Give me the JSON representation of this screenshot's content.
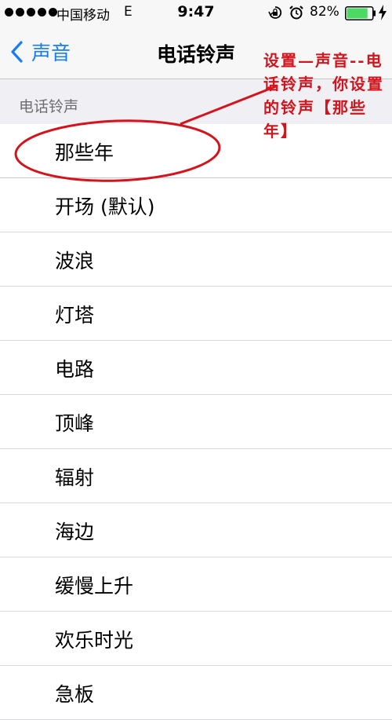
{
  "status_bar": {
    "carrier": "中国移动",
    "network": "E",
    "time": "9:47",
    "battery_percent": "82%",
    "battery_level": 0.82,
    "icons": [
      "signal-dots-icon",
      "rotation-lock-icon",
      "alarm-icon",
      "battery-icon",
      "charging-bolt-icon"
    ]
  },
  "nav": {
    "back_label": "声音",
    "title": "电话铃声"
  },
  "section": {
    "header": "电话铃声"
  },
  "ringtones": [
    "那些年",
    "开场 (默认)",
    "波浪",
    "灯塔",
    "电路",
    "顶峰",
    "辐射",
    "海边",
    "缓慢上升",
    "欢乐时光",
    "急板"
  ],
  "annotation": {
    "text": "设置—声音--电话铃声，你设置的铃声【那些年】",
    "color": "#d4141c"
  },
  "colors": {
    "accent": "#1a7cf5",
    "bar_background": "#f7f7f7",
    "group_background": "#efeff4",
    "battery_fill": "#4cd964"
  }
}
